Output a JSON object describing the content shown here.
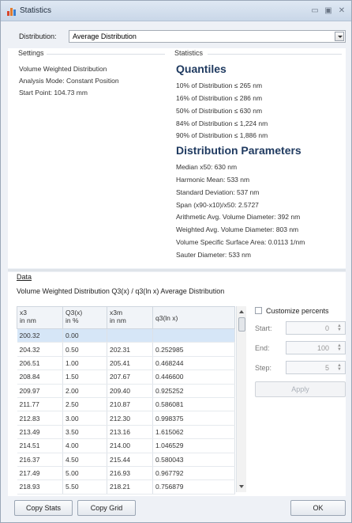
{
  "window": {
    "title": "Statistics",
    "controls": [
      "minimize-icon",
      "maximize-icon",
      "close-icon"
    ]
  },
  "distribution": {
    "label": "Distribution:",
    "value": "Average Distribution"
  },
  "settings": {
    "title": "Settings",
    "lines": [
      "Volume Weighted Distribution",
      "Analysis Mode: Constant Position",
      "Start Point: 104.73 mm"
    ]
  },
  "statistics": {
    "title": "Statistics",
    "quantiles_heading": "Quantiles",
    "quantiles": [
      "10% of Distribution ≤ 265 nm",
      "16% of Distribution ≤ 286 nm",
      "50% of Distribution ≤ 630 nm",
      "84% of Distribution ≤ 1,224 nm",
      "90% of Distribution ≤ 1,886 nm"
    ],
    "params_heading": "Distribution Parameters",
    "params": [
      "Median x50: 630 nm",
      "Harmonic Mean: 533 nm",
      "Standard Deviation: 537 nm",
      "Span (x90-x10)/x50: 2.5727",
      "Arithmetic Avg. Volume Diameter: 392 nm",
      "Weighted Avg. Volume Diameter: 803 nm",
      "Volume Specific Surface Area: 0.0113 1/nm",
      "Sauter Diameter: 533 nm"
    ]
  },
  "data": {
    "title": "Data",
    "subtitle": "Volume Weighted Distribution Q3(x) / q3(ln x) Average Distribution",
    "columns": [
      [
        "x3",
        "in nm"
      ],
      [
        "Q3(x)",
        "in %"
      ],
      [
        "x3m",
        "in nm"
      ],
      [
        "q3(ln x)",
        ""
      ]
    ],
    "rows": [
      [
        "200.32",
        "0.00",
        "",
        ""
      ],
      [
        "204.32",
        "0.50",
        "202.31",
        "0.252985"
      ],
      [
        "206.51",
        "1.00",
        "205.41",
        "0.468244"
      ],
      [
        "208.84",
        "1.50",
        "207.67",
        "0.446600"
      ],
      [
        "209.97",
        "2.00",
        "209.40",
        "0.925252"
      ],
      [
        "211.77",
        "2.50",
        "210.87",
        "0.586081"
      ],
      [
        "212.83",
        "3.00",
        "212.30",
        "0.998375"
      ],
      [
        "213.49",
        "3.50",
        "213.16",
        "1.615062"
      ],
      [
        "214.51",
        "4.00",
        "214.00",
        "1.046529"
      ],
      [
        "216.37",
        "4.50",
        "215.44",
        "0.580043"
      ],
      [
        "217.49",
        "5.00",
        "216.93",
        "0.967792"
      ],
      [
        "218.93",
        "5.50",
        "218.21",
        "0.756879"
      ]
    ]
  },
  "customize": {
    "checkbox_label": "Customize percents",
    "start_label": "Start:",
    "start_value": "0",
    "end_label": "End:",
    "end_value": "100",
    "step_label": "Step:",
    "step_value": "5",
    "apply_label": "Apply"
  },
  "footer": {
    "copy_stats": "Copy Stats",
    "copy_grid": "Copy Grid",
    "ok": "OK"
  },
  "colors": {
    "heading": "#1f3a60",
    "selection": "#d6e6f7"
  }
}
